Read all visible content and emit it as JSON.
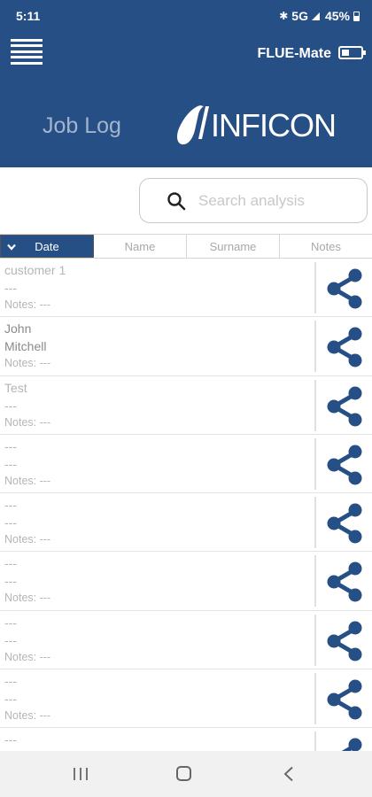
{
  "status_bar": {
    "time": "5:11",
    "network": "5G",
    "battery_percent": "45%"
  },
  "header": {
    "device_name": "FLUE-Mate",
    "page_title": "Job Log",
    "logo_text": "INFICON"
  },
  "search": {
    "placeholder": "Search analysis",
    "value": ""
  },
  "tabs": [
    {
      "label": "Date",
      "active": true
    },
    {
      "label": "Name",
      "active": false
    },
    {
      "label": "Surname",
      "active": false
    },
    {
      "label": "Notes",
      "active": false
    }
  ],
  "rows": [
    {
      "line1": "customer 1",
      "line2": "---",
      "notes": "Notes: ---"
    },
    {
      "line1": "John",
      "line2": "Mitchell",
      "notes": "Notes: ---"
    },
    {
      "line1": "Test",
      "line2": "---",
      "notes": "Notes: ---"
    },
    {
      "line1": "---",
      "line2": "---",
      "notes": "Notes: ---"
    },
    {
      "line1": "---",
      "line2": "---",
      "notes": "Notes: ---"
    },
    {
      "line1": "---",
      "line2": "---",
      "notes": "Notes: ---"
    },
    {
      "line1": "---",
      "line2": "---",
      "notes": "Notes: ---"
    },
    {
      "line1": "---",
      "line2": "---",
      "notes": "Notes: ---"
    },
    {
      "line1": "---",
      "line2": "",
      "notes": ""
    }
  ],
  "colors": {
    "header_bg": "#264f85",
    "share_icon": "#264f85",
    "active_tab_bg": "#264f85"
  },
  "icons": {
    "menu": "hamburger-menu-icon",
    "battery": "battery-icon",
    "search": "search-icon",
    "sort": "chevron-down-icon",
    "share": "share-icon"
  }
}
